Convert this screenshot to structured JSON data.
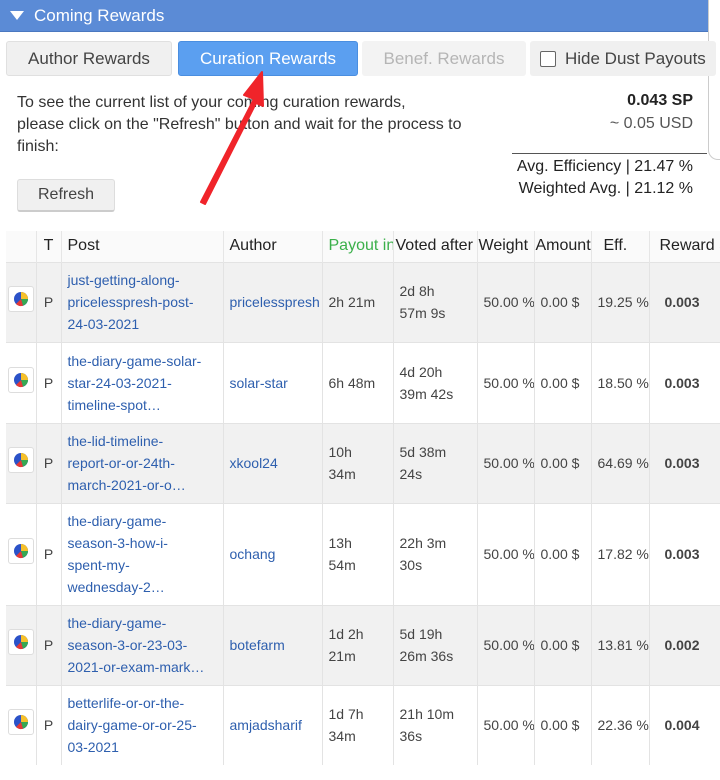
{
  "header": {
    "title": "Coming Rewards"
  },
  "tabs": {
    "author": "Author Rewards",
    "curation": "Curation Rewards",
    "benef": "Benef. Rewards",
    "hide_dust": "Hide Dust Payouts"
  },
  "info": {
    "line1": "To see the current list of your coming curation rewards,",
    "line2": "please click on the \"Refresh\" button and wait for the process to",
    "line3": "finish:",
    "sp": "0.043 SP",
    "usd": "~ 0.05 USD",
    "avg_eff": "Avg. Efficiency | 21.47 %",
    "weighted_avg": "Weighted Avg. | 21.12 %",
    "refresh": "Refresh"
  },
  "colors": {
    "header": "#5b8bd6",
    "active_tab": "#5b9ff0",
    "link": "#2e5fae",
    "payout_header": "#3bb04a",
    "arrow": "#f0242a"
  },
  "table": {
    "headers": {
      "t": "T",
      "post": "Post",
      "author": "Author",
      "payout": "Payout in",
      "voted": "Voted after",
      "weight": "Weight",
      "amount": "Amount",
      "eff": "Eff.",
      "reward": "Reward S"
    },
    "rows": [
      {
        "icon": "pie-chart-icon",
        "t": "P",
        "post1": "just-getting-along-",
        "post2": "pricelesspresh-post-",
        "post3": "24-03-2021",
        "author": "pricelesspresh",
        "payout1": "2h 21m",
        "payout2": "",
        "voted1": "2d 8h",
        "voted2": "57m 9s",
        "weight": "50.00 %",
        "amount": "0.00 $",
        "eff": "19.25 %",
        "reward": "0.003"
      },
      {
        "icon": "pie-chart-icon",
        "t": "P",
        "post1": "the-diary-game-solar-",
        "post2": "star-24-03-2021-",
        "post3": "timeline-spot…",
        "author": "solar-star",
        "payout1": "6h 48m",
        "payout2": "",
        "voted1": "4d 20h",
        "voted2": "39m 42s",
        "weight": "50.00 %",
        "amount": "0.00 $",
        "eff": "18.50 %",
        "reward": "0.003"
      },
      {
        "icon": "pie-chart-icon",
        "t": "P",
        "post1": "the-lid-timeline-",
        "post2": "report-or-or-24th-",
        "post3": "march-2021-or-o…",
        "author": "xkool24",
        "payout1": "10h",
        "payout2": "34m",
        "voted1": "5d 38m",
        "voted2": "24s",
        "weight": "50.00 %",
        "amount": "0.00 $",
        "eff": "64.69 %",
        "reward": "0.003"
      },
      {
        "icon": "pie-chart-icon",
        "t": "P",
        "post1": "the-diary-game-",
        "post2": "season-3-how-i-",
        "post3": "spent-my-",
        "post4": "wednesday-2…",
        "author": "ochang",
        "payout1": "13h",
        "payout2": "54m",
        "voted1": "22h 3m",
        "voted2": "30s",
        "weight": "50.00 %",
        "amount": "0.00 $",
        "eff": "17.82 %",
        "reward": "0.003"
      },
      {
        "icon": "pie-chart-icon",
        "t": "P",
        "post1": "the-diary-game-",
        "post2": "season-3-or-23-03-",
        "post3": "2021-or-exam-mark…",
        "author": "botefarm",
        "payout1": "1d 2h",
        "payout2": "21m",
        "voted1": "5d 19h",
        "voted2": "26m 36s",
        "weight": "50.00 %",
        "amount": "0.00 $",
        "eff": "13.81 %",
        "reward": "0.002"
      },
      {
        "icon": "pie-chart-icon",
        "t": "P",
        "post1": "betterlife-or-or-the-",
        "post2": "dairy-game-or-or-25-",
        "post3": "03-2021",
        "author": "amjadsharif",
        "payout1": "1d 7h",
        "payout2": "34m",
        "voted1": "21h 10m",
        "voted2": "36s",
        "weight": "50.00 %",
        "amount": "0.00 $",
        "eff": "22.36 %",
        "reward": "0.004"
      }
    ]
  }
}
